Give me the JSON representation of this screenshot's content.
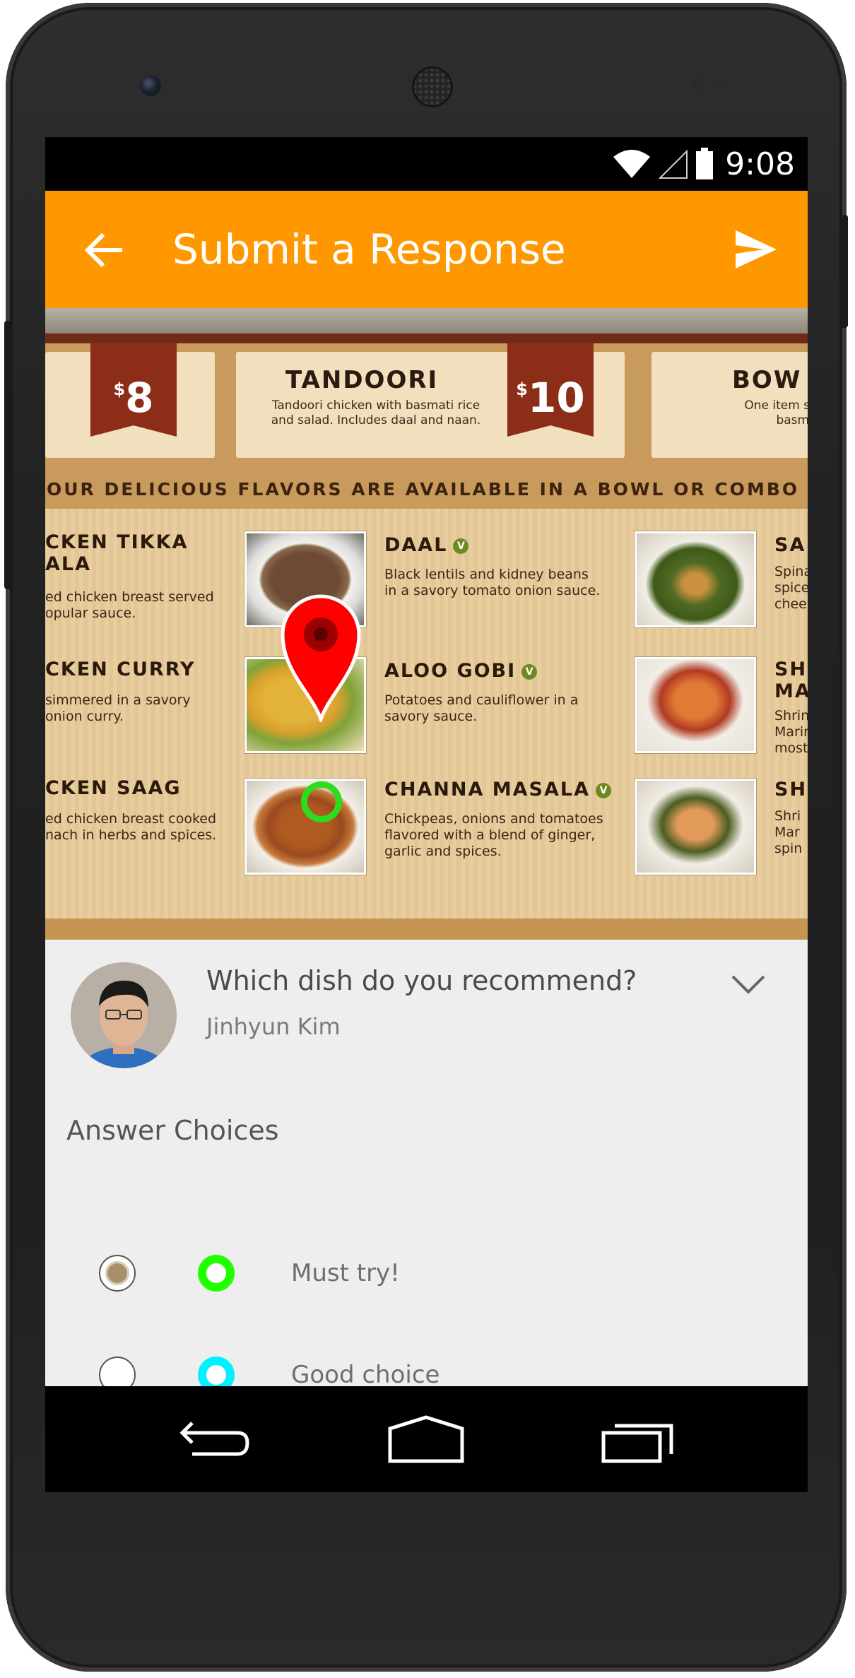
{
  "status_bar": {
    "time": "9:08",
    "icons": [
      "wifi-icon",
      "signal-icon",
      "battery-icon"
    ]
  },
  "app_bar": {
    "title": "Submit a Response",
    "back_icon": "arrow-left-icon",
    "send_icon": "send-icon",
    "color": "#FF9800"
  },
  "menu_photo": {
    "cards": [
      {
        "price": "8",
        "heading": "",
        "desc": []
      },
      {
        "price": "10",
        "heading": "TANDOORI",
        "desc": [
          "Tandoori chicken with basmati rice",
          "and salad. Includes daal and naan."
        ]
      },
      {
        "heading": "BOW",
        "desc": [
          "One item serve",
          "basmati ri"
        ]
      }
    ],
    "banner": "OUR DELICIOUS FLAVORS ARE AVAILABLE IN A BOWL OR COMBO",
    "dishes_left": [
      {
        "name": "CKEN TIKKA",
        "name2": "ALA",
        "desc": [
          "ed chicken breast served",
          "opular sauce."
        ]
      },
      {
        "name": "CKEN CURRY",
        "desc": [
          "simmered in a savory",
          "onion curry."
        ]
      },
      {
        "name": "CKEN SAAG",
        "desc": [
          "ed chicken breast cooked",
          "nach in herbs and spices."
        ]
      }
    ],
    "dishes_mid": [
      {
        "name": "DAAL",
        "veg": "V",
        "desc": [
          "Black lentils and kidney beans",
          "in a savory tomato onion sauce."
        ]
      },
      {
        "name": "ALOO GOBI",
        "veg": "V",
        "desc": [
          "Potatoes and cauliflower in a",
          "savory sauce."
        ]
      },
      {
        "name": "CHANNA MASALA",
        "veg": "V",
        "desc": [
          "Chickpeas, onions and tomatoes",
          "flavored with a blend of ginger,",
          "garlic and spices."
        ]
      }
    ],
    "dishes_right": [
      {
        "name": "SA",
        "desc": [
          "Spina",
          "spice",
          "chee"
        ]
      },
      {
        "name": "SH",
        "name2": "MA",
        "desc": [
          "Shrin",
          "Marin",
          "most"
        ]
      },
      {
        "name": "SH",
        "desc": [
          "Shri",
          "Mar",
          "spin"
        ]
      }
    ]
  },
  "question_panel": {
    "question": "Which dish do you recommend?",
    "asker": "Jinhyun Kim",
    "expand_icon": "chevron-down-icon",
    "answer_title": "Answer Choices",
    "choices": [
      {
        "label": "Must try!",
        "selected": true,
        "marker_color": "#22ff00"
      },
      {
        "label": "Good choice",
        "selected": false,
        "marker_color": "#00f2ff"
      }
    ]
  },
  "nav_bar": {
    "icons": [
      "back-nav-icon",
      "home-nav-icon",
      "recents-nav-icon"
    ]
  }
}
